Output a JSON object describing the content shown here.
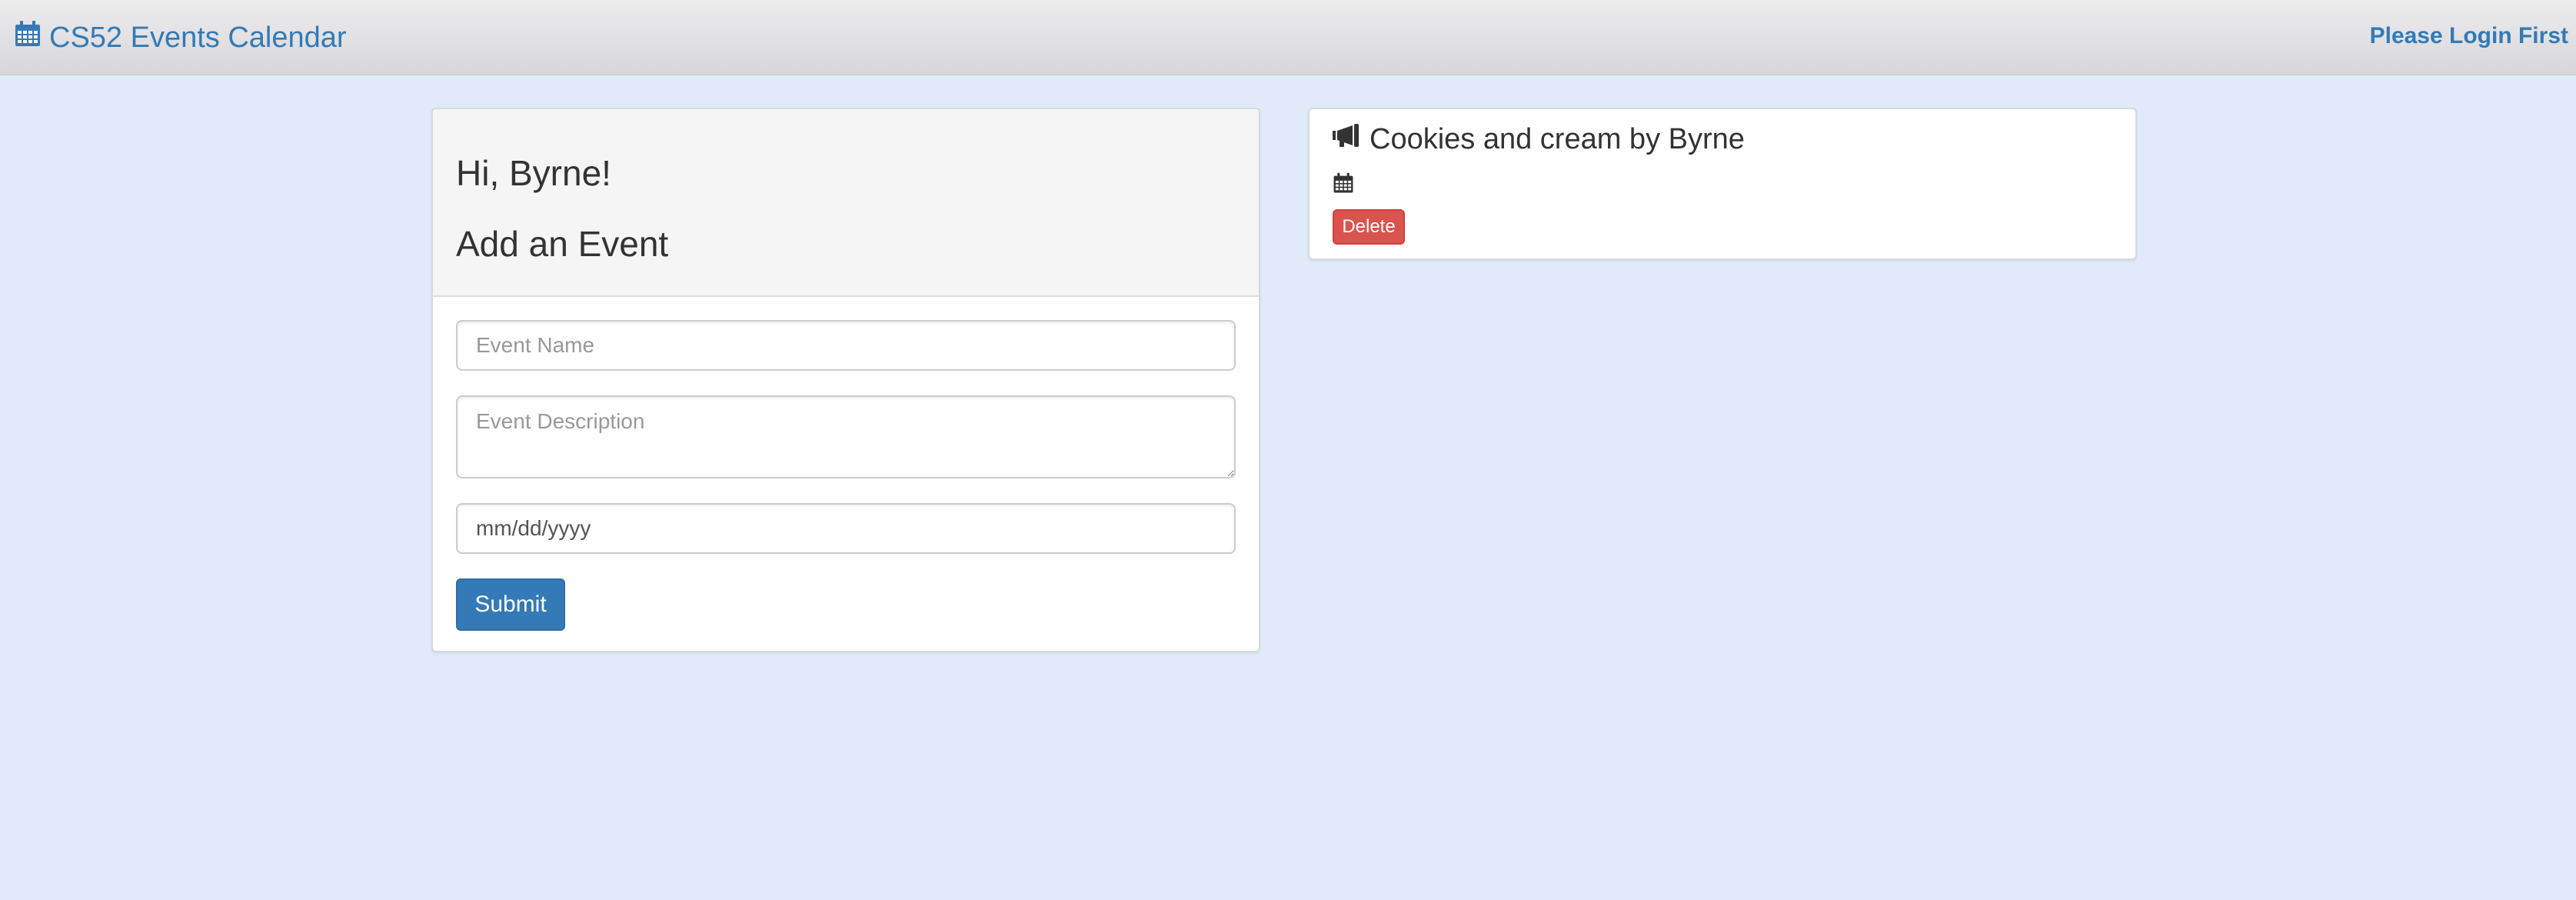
{
  "navbar": {
    "brand_icon": "calendar-icon",
    "brand_label": "CS52 Events Calendar",
    "login_label": "Please Login First"
  },
  "form_panel": {
    "greeting": "Hi, Byrne!",
    "title": "Add an Event",
    "event_name_placeholder": "Event Name",
    "event_description_placeholder": "Event Description",
    "date_value": "mm/dd/yyyy",
    "submit_label": "Submit"
  },
  "event_panel": {
    "title_icon": "megaphone-icon",
    "title": "Cookies and cream by Byrne",
    "date_icon": "calendar-icon",
    "delete_label": "Delete"
  },
  "colors": {
    "accent": "#337ab7",
    "danger": "#d9534f",
    "background": "#e0eaf9"
  }
}
